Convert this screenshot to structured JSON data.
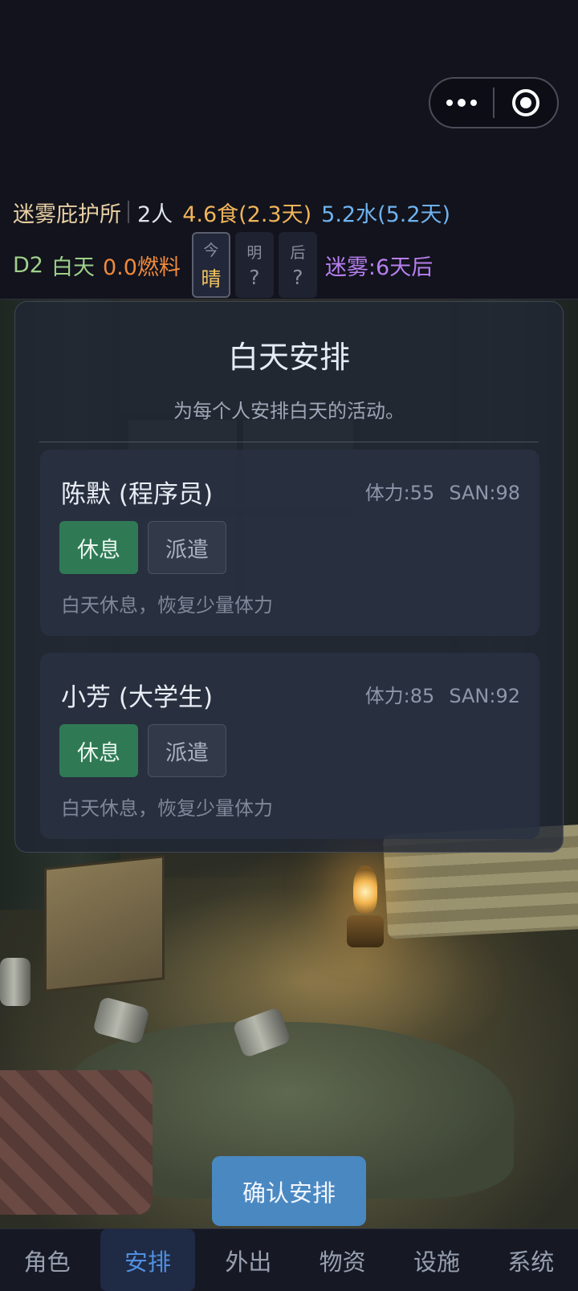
{
  "status": {
    "shelter_name": "迷雾庇护所",
    "people": "2人",
    "food": "4.6食(2.3天)",
    "water": "5.2水(5.2天)",
    "day": "D2",
    "period": "白天",
    "fuel": "0.0燃料",
    "forecast": [
      {
        "label": "今",
        "value": "晴"
      },
      {
        "label": "明",
        "value": "?"
      },
      {
        "label": "后",
        "value": "?"
      }
    ],
    "fog": "迷雾:6天后"
  },
  "dialog": {
    "title": "白天安排",
    "subtitle": "为每个人安排白天的活动。",
    "members": [
      {
        "name": "陈默 (程序员)",
        "stamina": "体力:55",
        "san": "SAN:98",
        "rest_label": "休息",
        "dispatch_label": "派遣",
        "selected": "rest",
        "description": "白天休息，恢复少量体力"
      },
      {
        "name": "小芳 (大学生)",
        "stamina": "体力:85",
        "san": "SAN:92",
        "rest_label": "休息",
        "dispatch_label": "派遣",
        "selected": "rest",
        "description": "白天休息，恢复少量体力"
      }
    ]
  },
  "confirm_label": "确认安排",
  "tabs": [
    {
      "label": "角色"
    },
    {
      "label": "安排",
      "active": true
    },
    {
      "label": "外出"
    },
    {
      "label": "物资"
    },
    {
      "label": "设施"
    },
    {
      "label": "系统"
    }
  ],
  "colors": {
    "selected_green": "#2f7a55",
    "confirm_blue": "#4a88c2",
    "active_tab": "#4f8fe0",
    "food": "#f0b45a",
    "water": "#6fb3f0",
    "fuel": "#f08a3c",
    "fog": "#b77ff0"
  }
}
